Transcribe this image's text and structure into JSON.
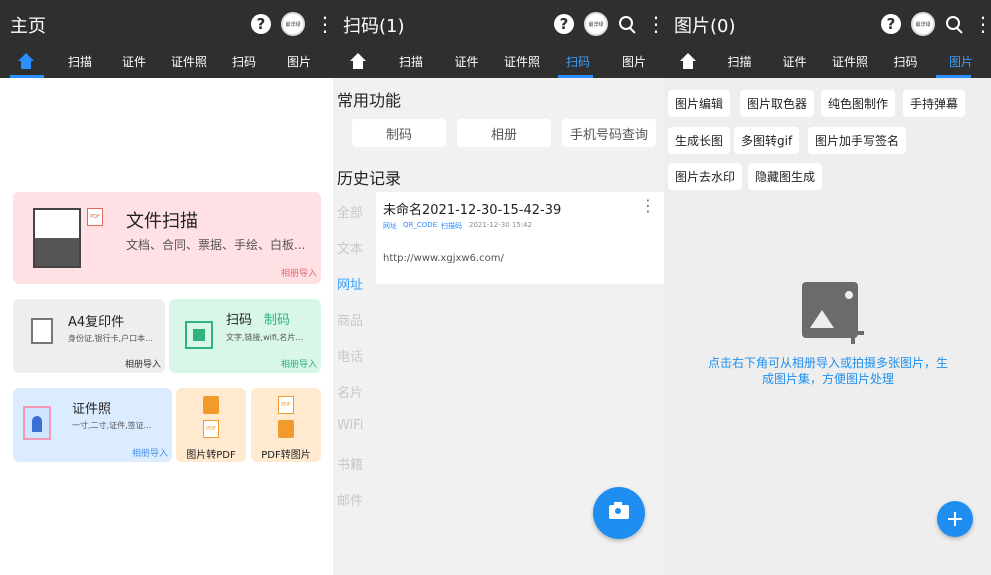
{
  "panel1": {
    "title": "主页",
    "avatar_text": "最洋绿",
    "tabs": [
      "证件",
      "证件照",
      "扫码",
      "图片"
    ],
    "tab_scan": "扫描",
    "card_file": {
      "title": "文件扫描",
      "desc": "文档、合同、票据、手绘、白板...",
      "action": "相册导入",
      "badge": "PDF"
    },
    "card_a4": {
      "title": "A4复印件",
      "desc": "身份证,银行卡,户口本...",
      "action": "相册导入"
    },
    "card_qr": {
      "title": "扫码",
      "title2": "制码",
      "desc": "文字,链接,wifi,名片...",
      "action": "相册导入"
    },
    "card_idphoto": {
      "title": "证件照",
      "desc": "一寸,二寸,证件,签证...",
      "action": "相册导入"
    },
    "card_img2pdf": {
      "label": "图片转PDF",
      "badge": "PDF"
    },
    "card_pdf2img": {
      "label": "PDF转图片",
      "badge": "PDF"
    }
  },
  "panel2": {
    "title": "扫码(1)",
    "avatar_text": "最洋绿",
    "tabs": [
      "扫描",
      "证件",
      "证件照",
      "扫码",
      "图片"
    ],
    "common_title": "常用功能",
    "buttons": [
      "制码",
      "相册",
      "手机号码查询"
    ],
    "history_title": "历史记录",
    "sidebar": [
      "全部",
      "文本",
      "网址",
      "商品",
      "电话",
      "名片",
      "WiFi",
      "书籍",
      "邮件"
    ],
    "record": {
      "name": "未命名2021-12-30-15-42-39",
      "tags": [
        "网址",
        "QR_CODE",
        "扫描码"
      ],
      "time": "2021-12-30 15:42",
      "url": "http://www.xgjxw6.com/"
    }
  },
  "panel3": {
    "title": "图片(0)",
    "avatar_text": "最洋绿",
    "tabs": [
      "扫描",
      "证件",
      "证件照",
      "扫码",
      "图片"
    ],
    "chips": [
      "图片编辑",
      "图片取色器",
      "纯色图制作",
      "手持弹幕",
      "生成长图",
      "多图转gif",
      "图片加手写签名",
      "图片去水印",
      "隐藏图生成"
    ],
    "empty_text": "点击右下角可从相册导入或拍摄多张图片，生成图片集，方便图片处理"
  },
  "colors": {
    "appbar": "#2f2f2f",
    "accent": "#2b8fff",
    "fab": "#1e8ff0"
  }
}
